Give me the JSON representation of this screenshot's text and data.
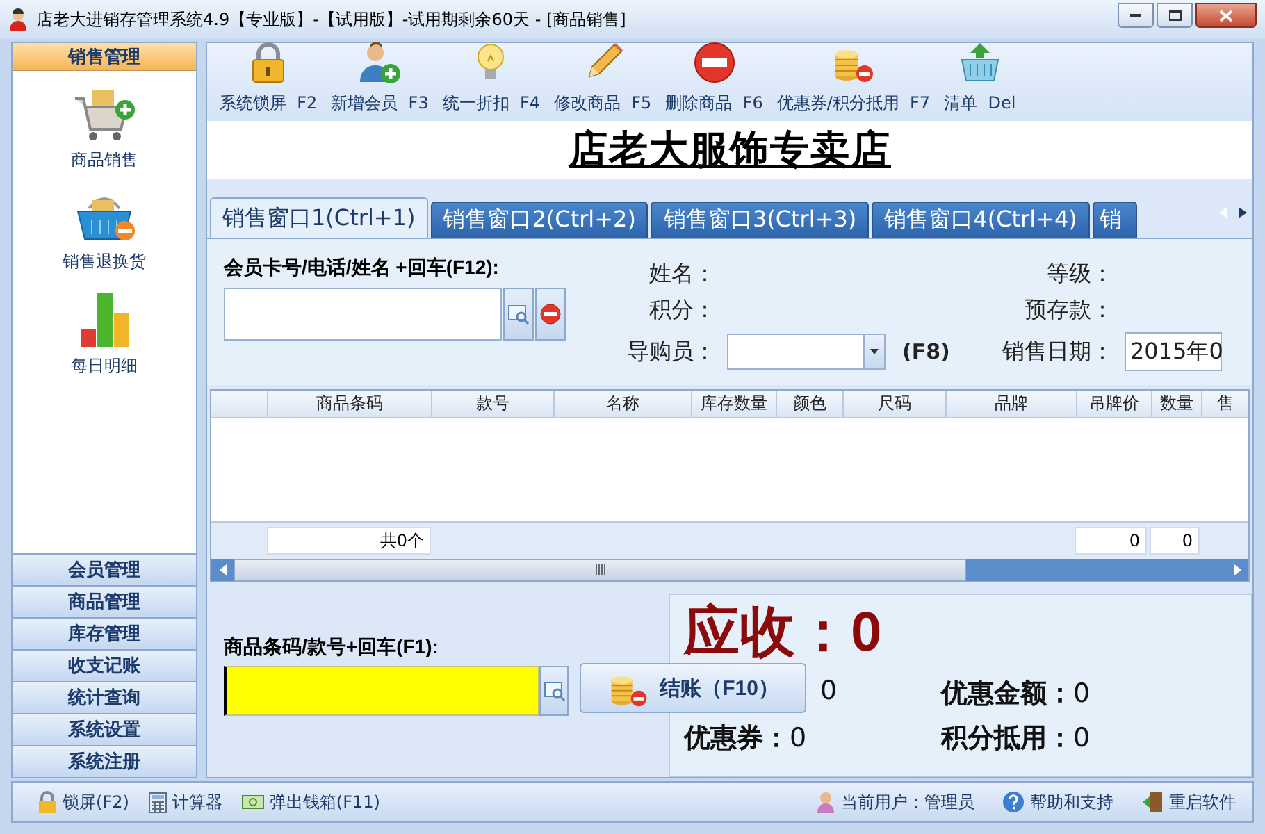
{
  "window": {
    "title": "店老大进销存管理系统4.9【专业版】-【试用版】-试用期剩余60天 - [商品销售]"
  },
  "sidebar": {
    "header": "销售管理",
    "items": [
      {
        "label": "商品销售"
      },
      {
        "label": "销售退换货"
      },
      {
        "label": "每日明细"
      }
    ],
    "sections": [
      "会员管理",
      "商品管理",
      "库存管理",
      "收支记账",
      "统计查询",
      "系统设置",
      "系统注册"
    ]
  },
  "toolbar": [
    {
      "label": "系统锁屏  F2"
    },
    {
      "label": "新增会员  F3"
    },
    {
      "label": "统一折扣  F4"
    },
    {
      "label": "修改商品  F5"
    },
    {
      "label": "删除商品  F6"
    },
    {
      "label": "优惠券/积分抵用  F7"
    },
    {
      "label": "清单  Del"
    }
  ],
  "shop_title": "店老大服饰专卖店",
  "tabs": [
    {
      "label": "销售窗口1(Ctrl+1)",
      "selected": true
    },
    {
      "label": "销售窗口2(Ctrl+2)",
      "selected": false
    },
    {
      "label": "销售窗口3(Ctrl+3)",
      "selected": false
    },
    {
      "label": "销售窗口4(Ctrl+4)",
      "selected": false
    },
    {
      "label": "销",
      "selected": false
    }
  ],
  "member": {
    "search_label": "会员卡号/电话/姓名 +回车(F12):",
    "name_label": "姓名：",
    "level_label": "等级：",
    "points_label": "积分：",
    "deposit_label": "预存款：",
    "guide_label": "导购员：",
    "guide_hotkey": "(F8)",
    "date_label": "销售日期：",
    "date": "2015年0"
  },
  "table": {
    "columns": [
      "商品条码",
      "款号",
      "名称",
      "库存数量",
      "颜色",
      "尺码",
      "品牌",
      "吊牌价",
      "数量",
      "售"
    ],
    "footer": {
      "count": "共0个",
      "total_1": "0",
      "total_2": "0"
    }
  },
  "product_entry": {
    "label": "商品条码/款号+回车(F1):"
  },
  "checkout_button": "结账（F10）",
  "summary": {
    "due_label": "应收：",
    "due": "0",
    "items": [
      {
        "kind": "covered",
        "value": "0"
      },
      {
        "kind": "labeled",
        "label": "优惠金额：",
        "value": "0"
      },
      {
        "kind": "labeled",
        "label": "优惠券：",
        "value": "0"
      },
      {
        "kind": "labeled",
        "label": "积分抵用：",
        "value": "0"
      }
    ]
  },
  "status_bar": {
    "left": [
      "锁屏(F2)",
      "计算器",
      "弹出钱箱(F11)"
    ],
    "right": [
      "当前用户：管理员",
      "帮助和支持",
      "重启软件"
    ]
  }
}
